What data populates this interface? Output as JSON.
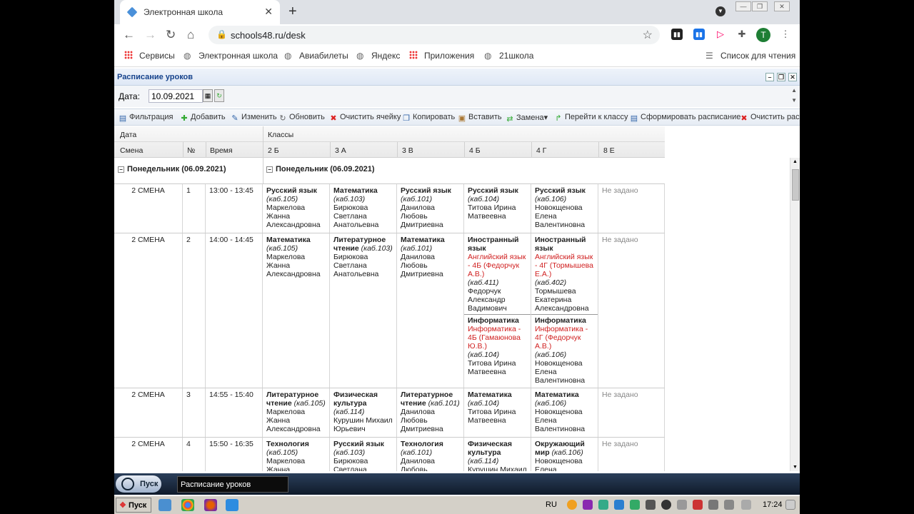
{
  "browser": {
    "tab_title": "Электронная школа",
    "url": "schools48.ru/desk",
    "avatar_letter": "T",
    "bookmarks": [
      "Сервисы",
      "Электронная школа",
      "Авиабилеты",
      "Яндекс",
      "Приложения",
      "21школа"
    ],
    "reading_list": "Список для чтения"
  },
  "window": {
    "title": "Расписание уроков",
    "date_label": "Дата:",
    "date_value": "10.09.2021"
  },
  "toolbar": {
    "filter": "Фильтрация",
    "add": "Добавить",
    "edit": "Изменить",
    "refresh": "Обновить",
    "clear_cell": "Очистить ячейку",
    "copy": "Копировать",
    "paste": "Вставить",
    "replace": "Замена",
    "goto_class": "Перейти к классу",
    "generate": "Сформировать расписание",
    "clear_schedule": "Очистить рас"
  },
  "grid": {
    "header": {
      "date": "Дата",
      "classes": "Классы",
      "shift": "Смена",
      "num": "№",
      "time": "Время",
      "class_names": [
        "2 Б",
        "3 А",
        "3 В",
        "4 Б",
        "4 Г",
        "8 Е"
      ]
    },
    "day_label": "Понедельник (06.09.2021)",
    "not_set": "Не задано",
    "rows": [
      {
        "shift": "2 СМЕНА",
        "num": "1",
        "time": "13:00 - 13:45"
      },
      {
        "shift": "2 СМЕНА",
        "num": "2",
        "time": "14:00 - 14:45"
      },
      {
        "shift": "2 СМЕНА",
        "num": "3",
        "time": "14:55 - 15:40"
      },
      {
        "shift": "2 СМЕНА",
        "num": "4",
        "time": "15:50 - 16:35"
      }
    ],
    "lessons": {
      "r1": [
        {
          "subject": "Русский язык",
          "room": "(каб.105)",
          "teacher": "Маркелова Жанна Александровна"
        },
        {
          "subject": "Математика",
          "room": "(каб.103)",
          "teacher": "Бирюкова Светлана Анатольевна"
        },
        {
          "subject": "Русский язык",
          "room": "(каб.101)",
          "teacher": "Данилова Любовь Дмитриевна"
        },
        {
          "subject": "Русский язык",
          "room": "(каб.104)",
          "teacher": "Титова Ирина Матвеевна"
        },
        {
          "subject": "Русский язык",
          "room": "(каб.106)",
          "teacher": "Новокщенова Елена Валентиновна"
        }
      ],
      "r2": [
        {
          "subject": "Математика",
          "room": "(каб.105)",
          "teacher": "Маркелова Жанна Александровна"
        },
        {
          "subject": "Литературное чтение",
          "room": "(каб.103)",
          "teacher": "Бирюкова Светлана Анатольевна"
        },
        {
          "subject": "Математика",
          "room": "(каб.101)",
          "teacher": "Данилова Любовь Дмитриевна"
        },
        {
          "subject": "Иностранный язык",
          "group": "Английский язык - 4Б (Федорчук А.В.)",
          "room": "(каб.411)",
          "teacher": "Федорчук Александр Вадимович",
          "subject2": "Информатика",
          "group2": "Информатика - 4Б (Гамаюнова Ю.В.)",
          "room2": "(каб.104)",
          "teacher2": "Титова Ирина Матвеевна"
        },
        {
          "subject": "Иностранный язык",
          "group": "Английский язык - 4Г (Тормышева Е.А.)",
          "room": "(каб.402)",
          "teacher": "Тормышева Екатерина Александровна",
          "subject2": "Информатика",
          "group2": "Информатика - 4Г (Федорчук А.В.)",
          "room2": "(каб.106)",
          "teacher2": "Новокщенова Елена Валентиновна"
        }
      ],
      "r3": [
        {
          "subject": "Литературное чтение",
          "room": "(каб.105)",
          "teacher": "Маркелова Жанна Александровна"
        },
        {
          "subject": "Физическая культура",
          "room": "(каб.114)",
          "teacher": "Курушин Михаил Юрьевич"
        },
        {
          "subject": "Литературное чтение",
          "room": "(каб.101)",
          "teacher": "Данилова Любовь Дмитриевна"
        },
        {
          "subject": "Математика",
          "room": "(каб.104)",
          "teacher": "Титова Ирина Матвеевна"
        },
        {
          "subject": "Математика",
          "room": "(каб.106)",
          "teacher": "Новокщенова Елена Валентиновна"
        }
      ],
      "r4": [
        {
          "subject": "Технология",
          "room": "(каб.105)",
          "teacher": "Маркелова Жанна"
        },
        {
          "subject": "Русский язык",
          "room": "(каб.103)",
          "teacher": "Бирюкова Светлана"
        },
        {
          "subject": "Технология",
          "room": "(каб.101)",
          "teacher": "Данилова Любовь"
        },
        {
          "subject": "Физическая культура",
          "room": "(каб.114)",
          "teacher": "Курушин Михаил"
        },
        {
          "subject": "Окружающий мир",
          "room": "(каб.106)",
          "teacher": "Новокщенова Елена"
        }
      ]
    }
  },
  "taskbar": {
    "start": "Пуск",
    "task_button": "Расписание уроков",
    "lang": "RU",
    "clock": "17:24"
  }
}
